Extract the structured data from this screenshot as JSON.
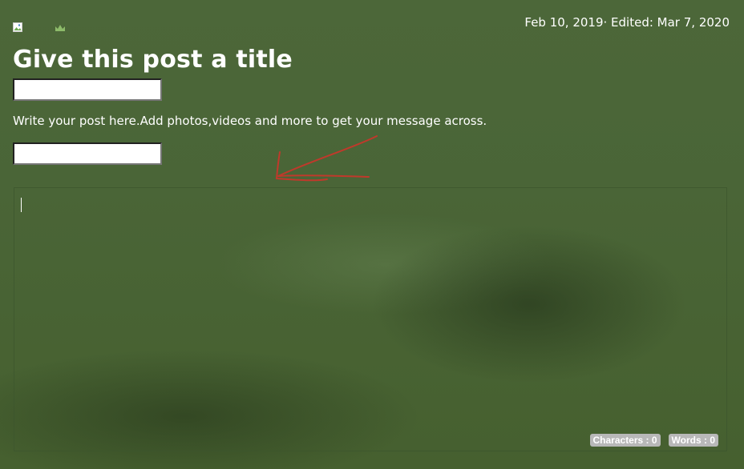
{
  "header": {
    "logo_icon": "broken-image-icon",
    "crown_icon": "crown-icon",
    "date_line": "Feb 10, 2019· Edited: Mar 7, 2020"
  },
  "post": {
    "title_heading": "Give this post a title",
    "title_input_value": "",
    "instructions": "Write your post here.Add photos,videos and more to get your message across.",
    "secondary_input_value": ""
  },
  "editor": {
    "content": "",
    "counters": {
      "characters_label": "Characters : 0",
      "words_label": "Words : 0"
    }
  },
  "colors": {
    "background": "#4a6436",
    "text": "#ffffff",
    "annotation_arrow": "#c0392b",
    "counter_badge": "#b8b8b8"
  }
}
